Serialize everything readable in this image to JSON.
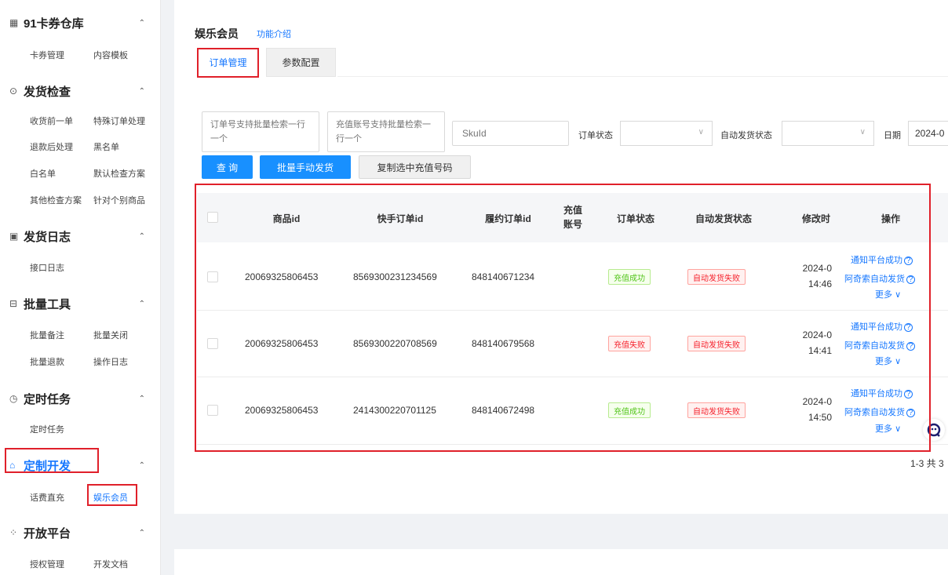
{
  "sidebar": {
    "groups": [
      {
        "label": "91卡券仓库",
        "icon": "grid-icon",
        "items": [
          "卡券管理",
          "内容模板"
        ]
      },
      {
        "label": "发货检查",
        "icon": "check-icon",
        "items": [
          "收货前一单",
          "特殊订单处理",
          "退款后处理",
          "黑名单",
          "白名单",
          "默认检查方案",
          "其他检查方案",
          "针对个别商品"
        ]
      },
      {
        "label": "发货日志",
        "icon": "log-icon",
        "items": [
          "接口日志"
        ]
      },
      {
        "label": "批量工具",
        "icon": "toolbox-icon",
        "items": [
          "批量备注",
          "批量关闭",
          "批量退款",
          "操作日志"
        ]
      },
      {
        "label": "定时任务",
        "icon": "clock-icon",
        "items": [
          "定时任务"
        ]
      },
      {
        "label": "定制开发",
        "icon": "home-icon",
        "items": [
          "话费直充",
          "娱乐会员"
        ]
      },
      {
        "label": "开放平台",
        "icon": "apps-icon",
        "items": [
          "授权管理",
          "开发文档"
        ]
      }
    ]
  },
  "page": {
    "title": "娱乐会员",
    "title_link": "功能介绍",
    "tabs": [
      "订单管理",
      "参数配置"
    ]
  },
  "filters": {
    "order_no_placeholder": "订单号支持批量检索一行一个",
    "recharge_placeholder": "充值账号支持批量检索一行一个",
    "skuid_placeholder": "SkuId",
    "order_status_label": "订单状态",
    "auto_ship_label": "自动发货状态",
    "date_label": "日期",
    "date_value": "2024-0"
  },
  "buttons": {
    "query": "查 询",
    "batch_ship": "批量手动发货",
    "copy": "复制选中充值号码"
  },
  "table": {
    "headers": [
      "商品id",
      "快手订单id",
      "履约订单id",
      "充值账号",
      "订单状态",
      "自动发货状态",
      "修改时",
      "操作"
    ],
    "rows": [
      {
        "product_id": "20069325806453",
        "ks_order": "8569300231234569",
        "fulfil_order": "848140671234",
        "status": "充值成功",
        "status_ok": true,
        "auto": "自动发货失败",
        "date1": "2024-0",
        "date2": "14:46"
      },
      {
        "product_id": "20069325806453",
        "ks_order": "8569300220708569",
        "fulfil_order": "848140679568",
        "status": "充值失败",
        "status_ok": false,
        "auto": "自动发货失败",
        "date1": "2024-0",
        "date2": "14:41"
      },
      {
        "product_id": "20069325806453",
        "ks_order": "2414300220701125",
        "fulfil_order": "848140672498",
        "status": "充值成功",
        "status_ok": true,
        "auto": "自动发货失败",
        "date1": "2024-0",
        "date2": "14:50"
      }
    ],
    "ops": {
      "notify": "通知平台成功",
      "auto_ship": "阿奇索自动发货",
      "more": "更多"
    }
  },
  "pagination": "1-3 共 3"
}
